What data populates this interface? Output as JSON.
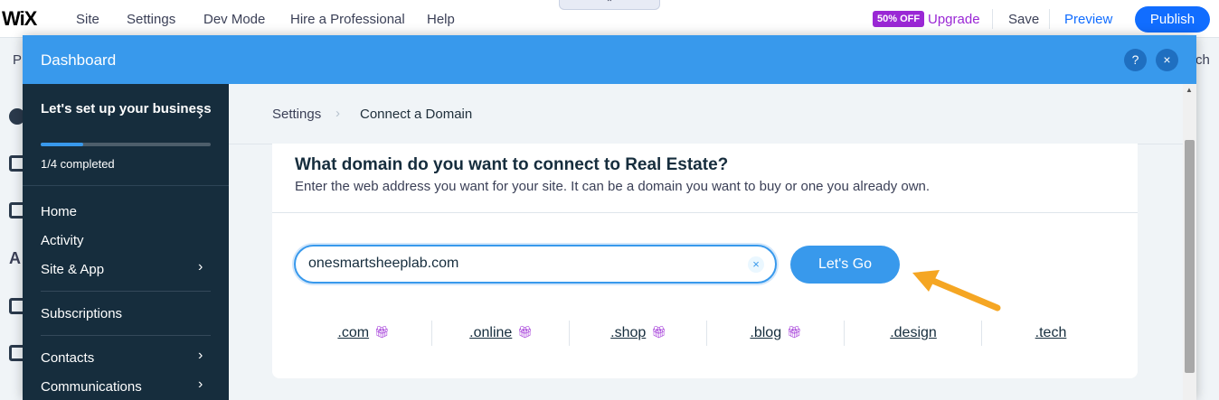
{
  "editor": {
    "logo": "WiX",
    "nav": [
      "Site",
      "Settings",
      "Dev Mode",
      "Hire a Professional",
      "Help"
    ],
    "collapse_icon": "chevron-up-icon",
    "badge": "50% OFF",
    "upgrade": "Upgrade",
    "save": "Save",
    "preview": "Preview",
    "publish": "Publish",
    "peek_left": "P",
    "peek_right": "ch",
    "peek_a": "A"
  },
  "dashboard": {
    "title": "Dashboard",
    "help_icon": "?",
    "close_icon": "×"
  },
  "sidebar": {
    "setup_title": "Let's set up your business",
    "progress_fraction": 0.25,
    "progress_label": "1/4 completed",
    "items": [
      {
        "label": "Home"
      },
      {
        "label": "Activity"
      },
      {
        "label": "Site & App"
      },
      {
        "label": "Subscriptions"
      },
      {
        "label": "Contacts"
      },
      {
        "label": "Communications"
      }
    ]
  },
  "breadcrumb": {
    "parent": "Settings",
    "separator": "›",
    "current": "Connect a Domain"
  },
  "card": {
    "title": "What domain do you want to connect to Real Estate?",
    "subtitle": "Enter the web address you want for your site. It can be a domain you want to buy or one you already own.",
    "input_value": "onesmartsheeplab.com",
    "clear_icon": "×",
    "button": "Let's Go"
  },
  "tlds": [
    {
      "label": ".com",
      "gift": true
    },
    {
      "label": ".online",
      "gift": true
    },
    {
      "label": ".shop",
      "gift": true
    },
    {
      "label": ".blog",
      "gift": true
    },
    {
      "label": ".design",
      "gift": false
    },
    {
      "label": ".tech",
      "gift": false
    }
  ],
  "colors": {
    "header_blue": "#3899ec",
    "sidebar_navy": "#162d3d",
    "accent_purple": "#9a27d5",
    "arrow_orange": "#f5a623"
  }
}
